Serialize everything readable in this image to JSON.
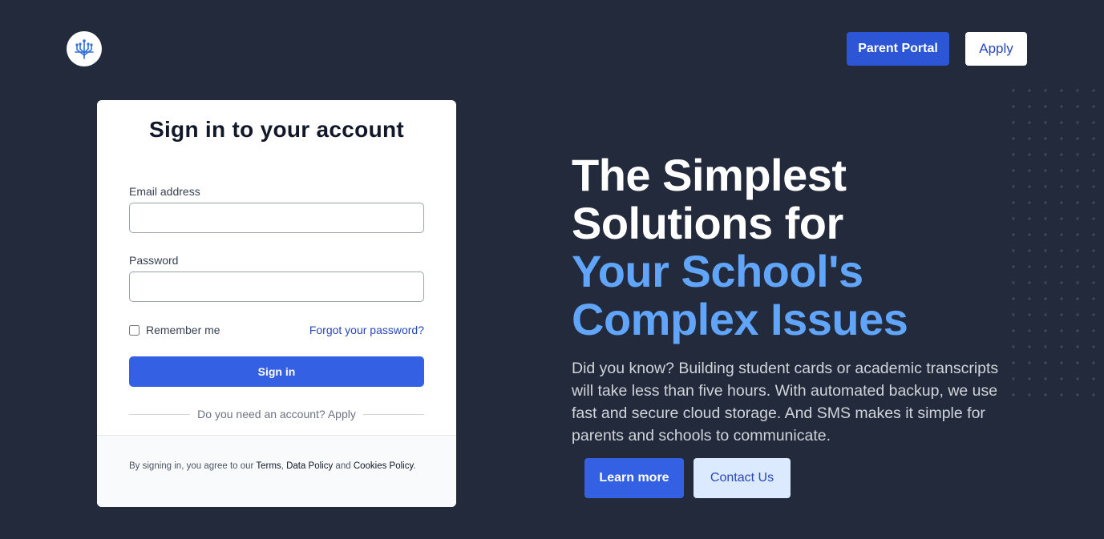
{
  "header": {
    "logo_icon": "circuit-tree-icon",
    "parent_portal_label": "Parent Portal",
    "apply_label": "Apply"
  },
  "signin": {
    "title": "Sign in to your account",
    "email_label": "Email address",
    "email_value": "",
    "password_label": "Password",
    "password_value": "",
    "remember_label": "Remember me",
    "remember_checked": false,
    "forgot_label": "Forgot your password?",
    "submit_label": "Sign in",
    "divider_text": "Do you need an account? Apply",
    "footer": {
      "prefix": "By signing in, you agree to our ",
      "terms": "Terms",
      "comma": ",",
      "data_policy": "Data Policy",
      "and": " and ",
      "cookies_policy": "Cookies Policy",
      "period": "."
    }
  },
  "hero": {
    "title_line1": "The Simplest",
    "title_line2": "Solutions for",
    "title_line3": "Your School's",
    "title_line4": "Complex Issues",
    "description": "Did you know? Building student cards or academic transcripts will take less than five hours. With automated backup, we use fast and secure cloud storage. And SMS makes it simple for parents and schools to communicate.",
    "learn_more_label": "Learn more",
    "contact_label": "Contact Us"
  },
  "colors": {
    "background": "#222a3b",
    "primary": "#3460e3",
    "accent_text": "#60a5fa",
    "link": "#2a47b8"
  }
}
